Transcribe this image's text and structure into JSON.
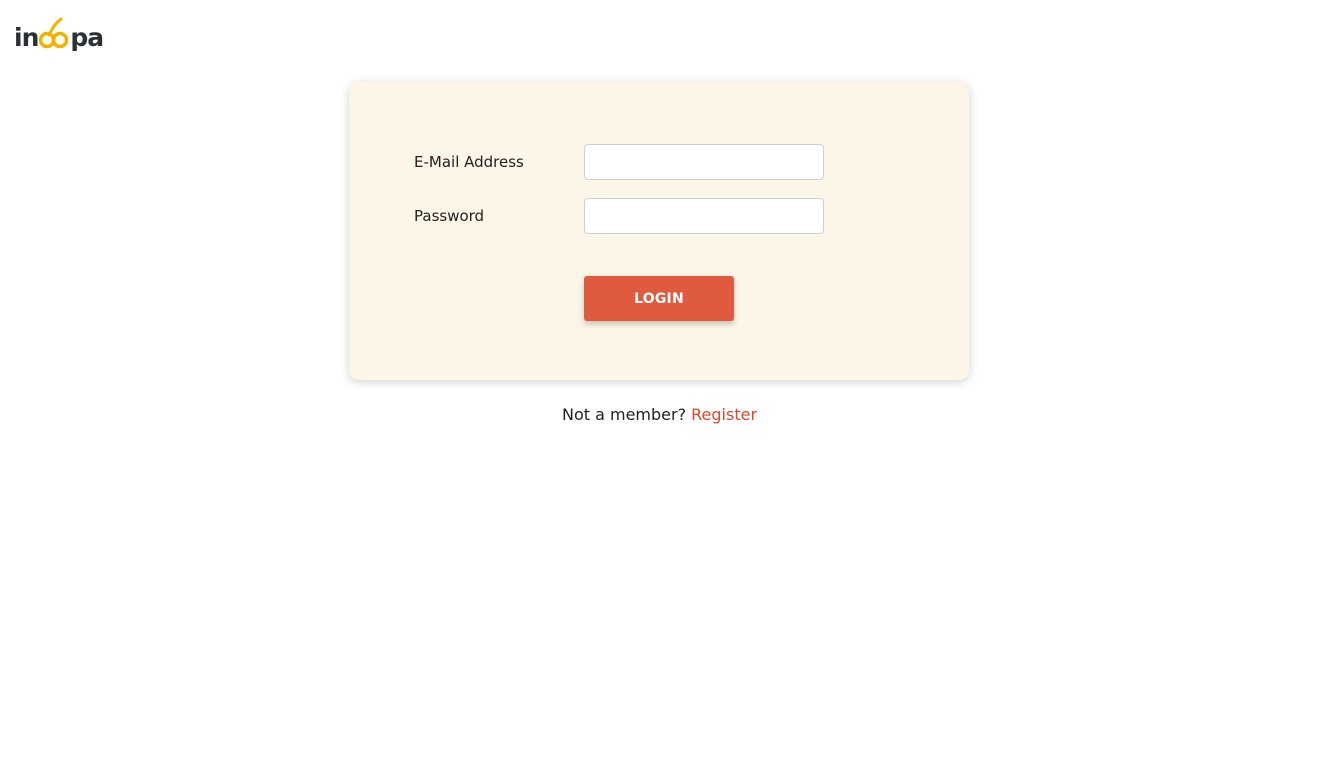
{
  "brand": {
    "logo_prefix": "in",
    "logo_suffix": "pa",
    "logo_alt": "inoopa",
    "colors": {
      "dark": "#2b3035",
      "accent": "#f2b300"
    }
  },
  "login_form": {
    "email_label": "E-Mail Address",
    "email_value": "",
    "email_placeholder": "",
    "password_label": "Password",
    "password_value": "",
    "password_placeholder": "",
    "submit_label": "LOGIN",
    "colors": {
      "card_background": "#fbf6e7",
      "button": "#e05a40"
    }
  },
  "footer": {
    "prompt": "Not a member?",
    "register_link": "Register",
    "link_color": "#d9472e"
  }
}
